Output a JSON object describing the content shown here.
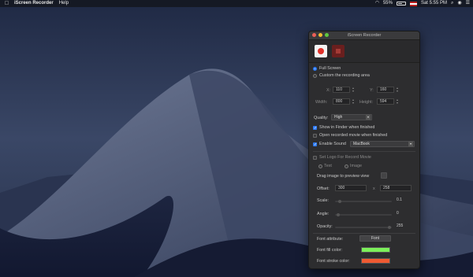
{
  "menubar": {
    "app_name": "iScreen Recorder",
    "menu_help": "Help",
    "battery_percent": "55%",
    "clock": "Sat 5:55 PM"
  },
  "window": {
    "title": "iScreen Recorder",
    "capture": {
      "full_screen_label": "Full Screen",
      "custom_area_label": "Custom the recording area",
      "x_label": "X:",
      "x_value": "110",
      "y_label": "Y:",
      "y_value": "160",
      "width_label": "Width:",
      "width_value": "800",
      "height_label": "Height:",
      "height_value": "594"
    },
    "quality": {
      "label": "Quality:",
      "selected": "High"
    },
    "options": {
      "show_in_finder": "Show in Finder when finished",
      "open_movie": "Open recorded movie when finished",
      "enable_sound": "Enable Sound",
      "sound_device": "MacBook"
    },
    "logo": {
      "set_logo_label": "Set Logo For Record Movie",
      "text_label": "Text",
      "image_label": "Image",
      "drag_label": "Drag image to preview view",
      "offset_label": "Offset:",
      "offset_x": "300",
      "offset_sep": "x",
      "offset_y": "258",
      "scale_label": "Scale:",
      "scale_value": "0.1",
      "angle_label": "Angle:",
      "angle_value": "0",
      "opacity_label": "Opacity:",
      "opacity_value": "255"
    },
    "font": {
      "attribute_label": "Font attribute:",
      "font_button": "Font",
      "fill_label": "Font fill color:",
      "stroke_label": "Font stroke color:",
      "fill_color": "#7cf05a",
      "stroke_color": "#f05a32"
    }
  },
  "icons": {
    "apple": "apple-icon",
    "wifi": "wifi-icon",
    "search": "search-icon",
    "siri": "siri-icon",
    "notifications": "notification-center-icon"
  }
}
